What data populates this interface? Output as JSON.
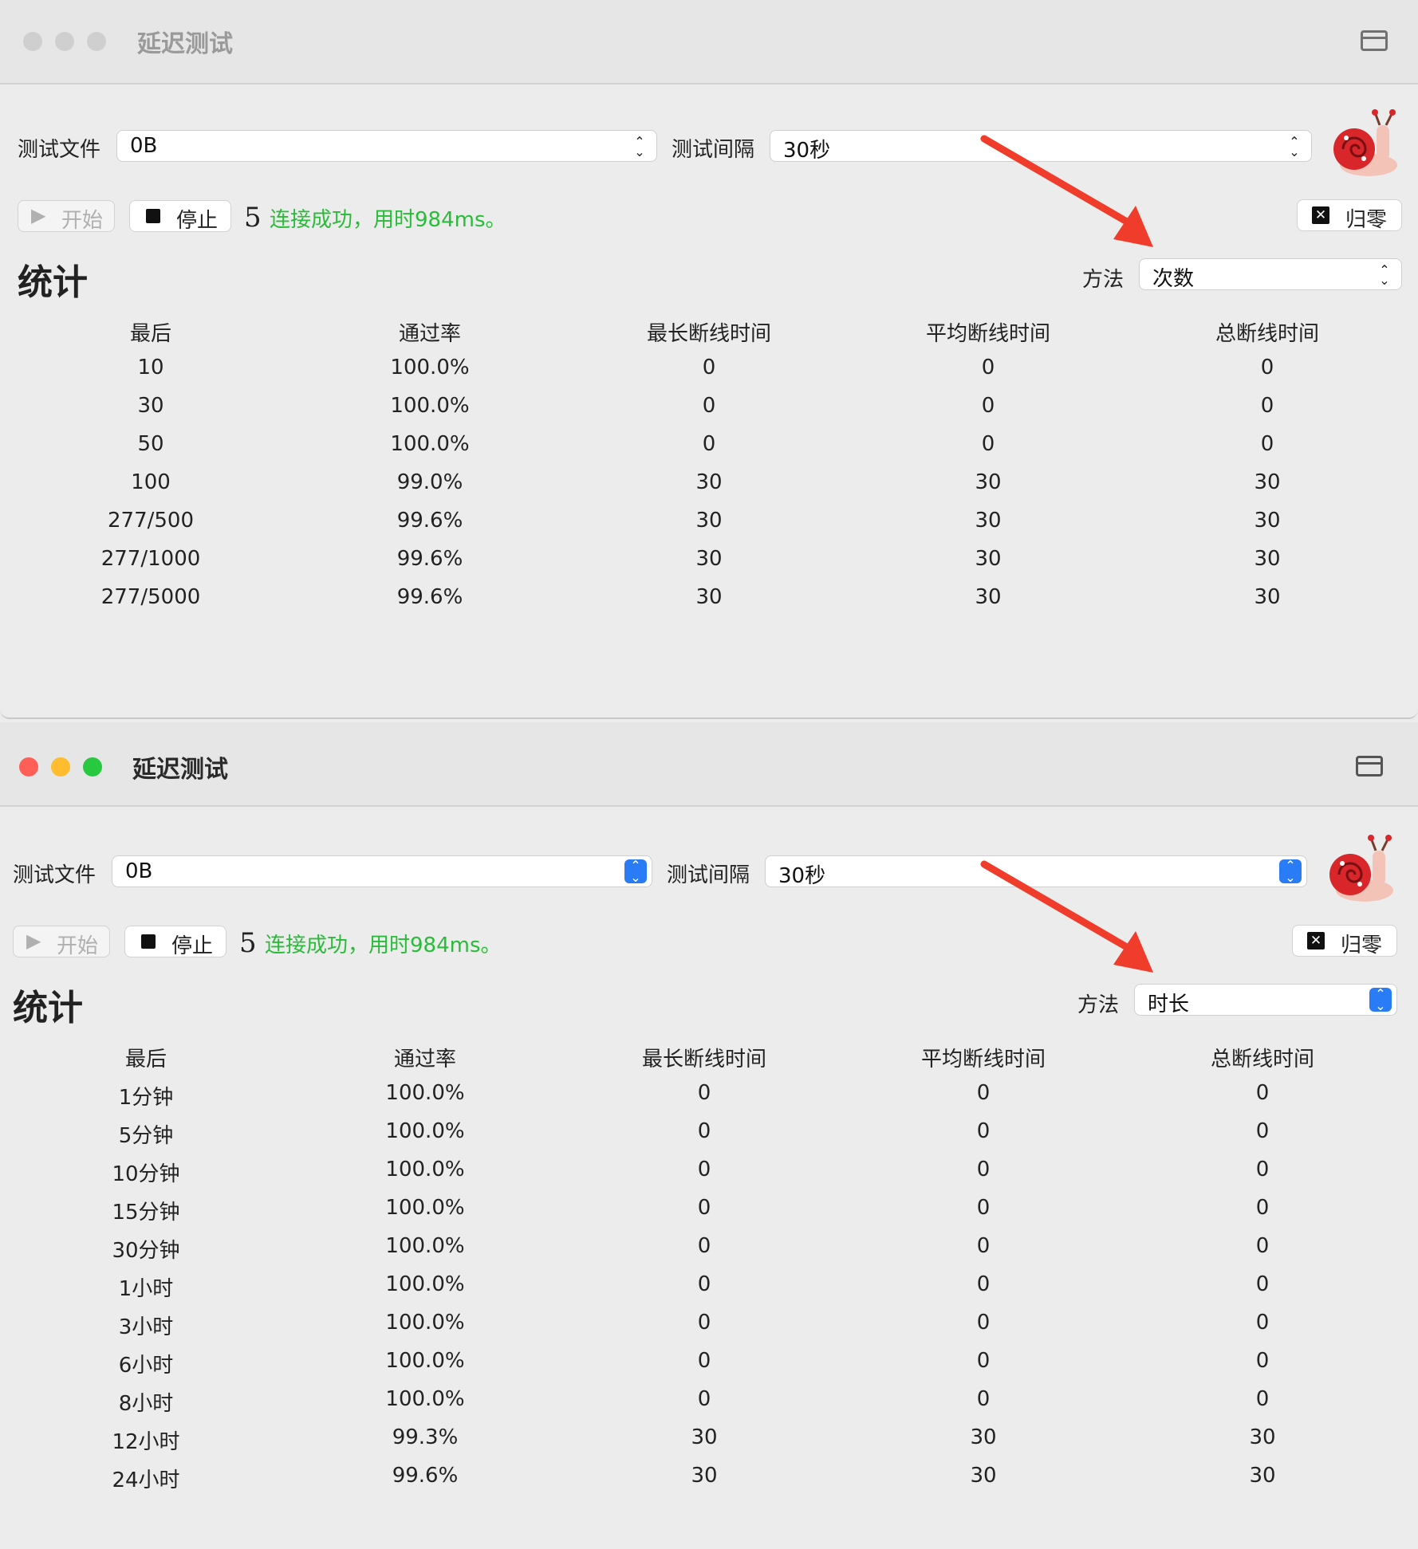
{
  "windows": [
    {
      "title": "延迟测试",
      "traffic_lights": [
        "#cfcfcf",
        "#cfcfcf",
        "#cfcfcf"
      ],
      "test_file_label": "测试文件",
      "test_file_value": "0B",
      "interval_label": "测试间隔",
      "interval_value": "30秒",
      "start_label": "开始",
      "stop_label": "停止",
      "count": "5",
      "status": "连接成功，用时984ms。",
      "reset_label": "归零",
      "stats_heading": "统计",
      "method_label": "方法",
      "method_value": "次数",
      "columns": [
        "最后",
        "通过率",
        "最长断线时间",
        "平均断线时间",
        "总断线时间"
      ],
      "rows": [
        [
          "10",
          "100.0%",
          "0",
          "0",
          "0"
        ],
        [
          "30",
          "100.0%",
          "0",
          "0",
          "0"
        ],
        [
          "50",
          "100.0%",
          "0",
          "0",
          "0"
        ],
        [
          "100",
          "99.0%",
          "30",
          "30",
          "30"
        ],
        [
          "277/500",
          "99.6%",
          "30",
          "30",
          "30"
        ],
        [
          "277/1000",
          "99.6%",
          "30",
          "30",
          "30"
        ],
        [
          "277/5000",
          "99.6%",
          "30",
          "30",
          "30"
        ]
      ]
    },
    {
      "title": "延迟测试",
      "traffic_lights": [
        "#ff5f57",
        "#febc2e",
        "#28c840"
      ],
      "test_file_label": "测试文件",
      "test_file_value": "0B",
      "interval_label": "测试间隔",
      "interval_value": "30秒",
      "start_label": "开始",
      "stop_label": "停止",
      "count": "5",
      "status": "连接成功，用时984ms。",
      "reset_label": "归零",
      "stats_heading": "统计",
      "method_label": "方法",
      "method_value": "时长",
      "columns": [
        "最后",
        "通过率",
        "最长断线时间",
        "平均断线时间",
        "总断线时间"
      ],
      "rows": [
        [
          "1分钟",
          "100.0%",
          "0",
          "0",
          "0"
        ],
        [
          "5分钟",
          "100.0%",
          "0",
          "0",
          "0"
        ],
        [
          "10分钟",
          "100.0%",
          "0",
          "0",
          "0"
        ],
        [
          "15分钟",
          "100.0%",
          "0",
          "0",
          "0"
        ],
        [
          "30分钟",
          "100.0%",
          "0",
          "0",
          "0"
        ],
        [
          "1小时",
          "100.0%",
          "0",
          "0",
          "0"
        ],
        [
          "3小时",
          "100.0%",
          "0",
          "0",
          "0"
        ],
        [
          "6小时",
          "100.0%",
          "0",
          "0",
          "0"
        ],
        [
          "8小时",
          "100.0%",
          "0",
          "0",
          "0"
        ],
        [
          "12小时",
          "99.3%",
          "30",
          "30",
          "30"
        ],
        [
          "24小时",
          "99.6%",
          "30",
          "30",
          "30"
        ]
      ]
    }
  ],
  "colors": {
    "status_green": "#2bbb3a",
    "arrow_red": "#f03c2a",
    "select_blue": "#2a7cf6"
  },
  "icons": [
    "play-icon",
    "stop-icon",
    "close-box-icon",
    "window-toggle-icon",
    "snail-mascot-icon",
    "red-arrow-annotation"
  ]
}
